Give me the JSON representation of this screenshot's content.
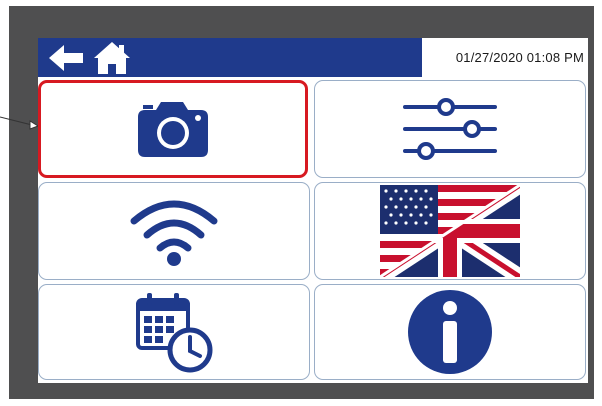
{
  "header": {
    "datetime": "01/27/2020 01:08 PM",
    "back_icon": "back-arrow-icon",
    "home_icon": "home-icon"
  },
  "tiles": [
    {
      "name": "camera",
      "icon": "camera-icon",
      "selected": true
    },
    {
      "name": "settings",
      "icon": "sliders-icon",
      "selected": false
    },
    {
      "name": "wifi",
      "icon": "wifi-icon",
      "selected": false
    },
    {
      "name": "language",
      "icon": "us-uk-flag-icon",
      "selected": false
    },
    {
      "name": "date-time",
      "icon": "calendar-clock-icon",
      "selected": false
    },
    {
      "name": "info",
      "icon": "info-icon",
      "selected": false
    }
  ],
  "colors": {
    "brand_blue": "#1f3a8c",
    "selection_red": "#d71921",
    "bezel_gray": "#4f4f50",
    "tile_border": "#9aaec7"
  }
}
